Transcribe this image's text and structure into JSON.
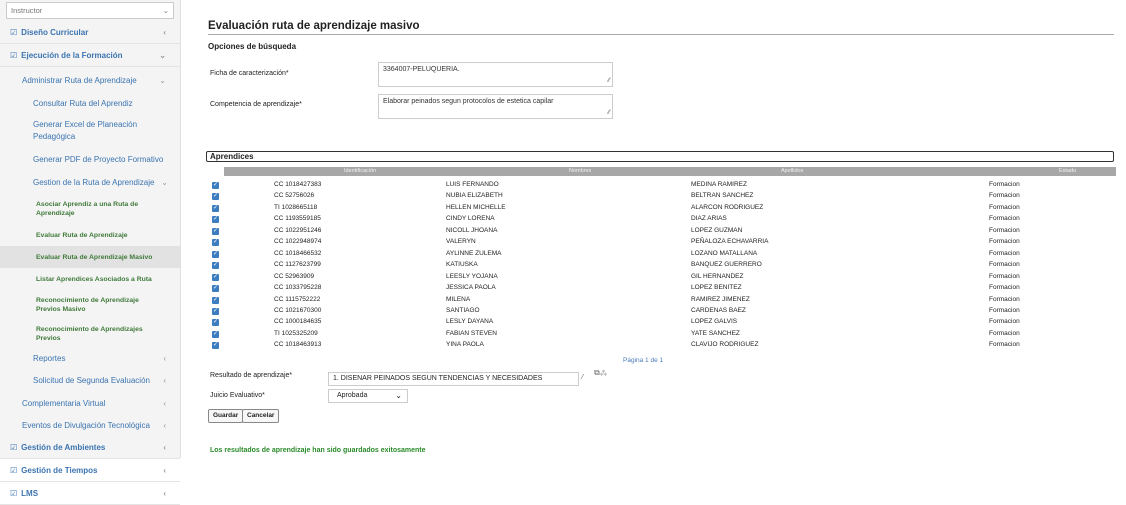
{
  "sidebar": {
    "role_select": "Instructor",
    "items": [
      {
        "label": "Diseño Curricular"
      },
      {
        "label": "Ejecución de la Formación"
      },
      {
        "label": "Administrar Ruta de Aprendizaje"
      },
      {
        "label": "Consultar Ruta del Aprendiz"
      },
      {
        "label": "Generar Excel de Planeación Pedagógica"
      },
      {
        "label": "Generar PDF de Proyecto Formativo"
      },
      {
        "label": "Gestion de la Ruta de Aprendizaje"
      },
      {
        "label": "Asociar Aprendiz a una Ruta de Aprendizaje"
      },
      {
        "label": "Evaluar Ruta de Aprendizaje"
      },
      {
        "label": "Evaluar Ruta de Aprendizaje Masivo"
      },
      {
        "label": "Listar Aprendices Asociados a Ruta"
      },
      {
        "label": "Reconocimiento de Aprendizaje Previos Masivo"
      },
      {
        "label": "Reconocimiento de Aprendizajes Previos"
      },
      {
        "label": "Reportes"
      },
      {
        "label": "Solicitud de Segunda Evaluación"
      },
      {
        "label": "Complementaria Virtual"
      },
      {
        "label": "Eventos de Divulgación Tecnológica"
      },
      {
        "label": "Gestión de Ambientes"
      },
      {
        "label": "Gestión de Tiempos"
      },
      {
        "label": "LMS"
      }
    ]
  },
  "main": {
    "title": "Evaluación ruta de aprendizaje masivo",
    "search_heading": "Opciones de búsqueda",
    "ficha_label": "Ficha de caracterización*",
    "ficha_value": "3364007-PELUQUERIA.",
    "competencia_label": "Competencia de aprendizaje*",
    "competencia_value": "Elaborar peinados segun protocolos de estetica capilar",
    "aprendices_heading": "Aprendices",
    "columns": [
      "Identificación",
      "Nombres",
      "Apellidos",
      "Estado"
    ],
    "rows": [
      {
        "id": "CC 1018427383",
        "nombres": "LUIS FERNANDO",
        "apellidos": "MEDINA RAMIREZ",
        "estado": "Formacion"
      },
      {
        "id": "CC 52756026",
        "nombres": "NUBIA ELIZABETH",
        "apellidos": "BELTRAN SANCHEZ",
        "estado": "Formacion"
      },
      {
        "id": "TI 1028665118",
        "nombres": "HELLEN MICHELLE",
        "apellidos": "ALARCON RODRIGUEZ",
        "estado": "Formacion"
      },
      {
        "id": "CC 1193559185",
        "nombres": "CINDY LORENA",
        "apellidos": "DIAZ ARIAS",
        "estado": "Formacion"
      },
      {
        "id": "CC 1022951246",
        "nombres": "NICOLL JHOANA",
        "apellidos": "LOPEZ GUZMAN",
        "estado": "Formacion"
      },
      {
        "id": "CC 1022948974",
        "nombres": "VALERYN",
        "apellidos": "PEÑALOZA ECHAVARRIA",
        "estado": "Formacion"
      },
      {
        "id": "CC 1018466532",
        "nombres": "AYLINNE ZULEMA",
        "apellidos": "LOZANO MATALLANA",
        "estado": "Formacion"
      },
      {
        "id": "CC 1127623799",
        "nombres": "KATIUSKA",
        "apellidos": "BANQUEZ GUERRERO",
        "estado": "Formacion"
      },
      {
        "id": "CC 52963909",
        "nombres": "LEESLY YOJANA",
        "apellidos": "GIL HERNANDEZ",
        "estado": "Formacion"
      },
      {
        "id": "CC 1033795228",
        "nombres": "JESSICA PAOLA",
        "apellidos": "LOPEZ BENITEZ",
        "estado": "Formacion"
      },
      {
        "id": "CC 1115752222",
        "nombres": "MILENA",
        "apellidos": "RAMIREZ JIMENEZ",
        "estado": "Formacion"
      },
      {
        "id": "CC 1021670300",
        "nombres": "SANTIAGO",
        "apellidos": "CARDENAS BAEZ",
        "estado": "Formacion"
      },
      {
        "id": "CC 1000184635",
        "nombres": "LESLY DAYANA",
        "apellidos": "LOPEZ GALVIS",
        "estado": "Formacion"
      },
      {
        "id": "TI 1025325209",
        "nombres": "FABIAN STEVEN",
        "apellidos": "YATE SANCHEZ",
        "estado": "Formacion"
      },
      {
        "id": "CC 1018463913",
        "nombres": "YINA PAOLA",
        "apellidos": "CLAVIJO RODRIGUEZ",
        "estado": "Formacion"
      }
    ],
    "pager": "Página 1 de 1",
    "resultado_label": "Resultado de aprendizaje*",
    "resultado_value": "1. DISENAR PEINADOS SEGUN TENDENCIAS Y NECESIDADES",
    "juicio_label": "Juicio Evaluativo*",
    "juicio_value": "Aprobada",
    "save_label": "Guardar",
    "cancel_label": "Cancelar",
    "success_message": "Los resultados de aprendizaje han sido guardados exitosamente"
  }
}
